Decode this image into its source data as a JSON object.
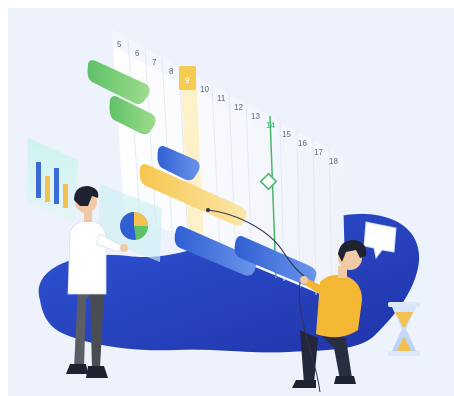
{
  "illustration": {
    "subject": "project-timeline-gantt",
    "colors": {
      "background": "#eef2fd",
      "blob": "#2a47c8",
      "board": "#ffffff",
      "green_bar": "#79cd73",
      "blue_bar": "#3a6bd8",
      "yellow_bar": "#f5cf6a",
      "highlight_column": "#f5cb51",
      "milestone_line": "#49b86b",
      "shirt_yellow": "#f4b734",
      "skin": "#f1c9a5",
      "hair": "#1e2231"
    },
    "timeline_dates": [
      "5",
      "6",
      "7",
      "8",
      "9",
      "10",
      "11",
      "12",
      "13",
      "14",
      "15",
      "16",
      "17",
      "18"
    ],
    "highlighted_date": "9",
    "milestone_date": "14",
    "bubble_lines": [
      "·····",
      "·······"
    ]
  }
}
